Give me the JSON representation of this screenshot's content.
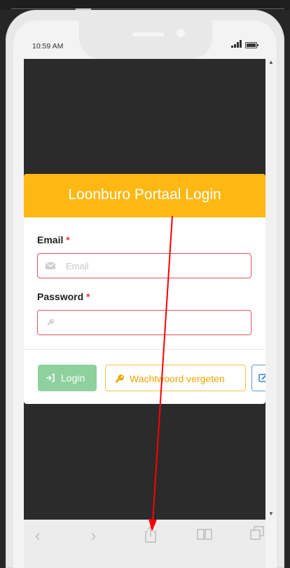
{
  "status_bar": {
    "time": "10:59 AM"
  },
  "login": {
    "title": "Loonburo Portaal Login",
    "email_label": "Email",
    "email_placeholder": "Email",
    "password_label": "Password",
    "password_placeholder": "",
    "required_marker": "*",
    "login_button": "Login",
    "forgot_button": "Wachtwoord vergeten"
  },
  "browser_toolbar": {
    "icons": [
      "chevron-left-icon",
      "chevron-right-icon",
      "share-icon",
      "bookmarks-icon",
      "tabs-icon"
    ]
  },
  "colors": {
    "header": "#fdb813",
    "login_button": "#8ed19e",
    "forgot_border": "#f6c145",
    "input_border_error": "#e05563",
    "annotation_arrow": "#ff0000"
  }
}
